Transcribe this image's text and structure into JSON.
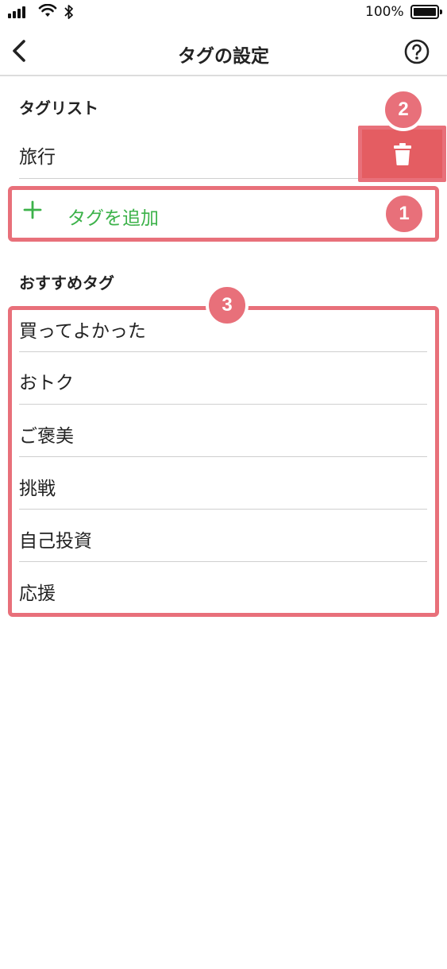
{
  "status_bar": {
    "battery_percent": "100%",
    "icons": [
      "cellular-signal-icon",
      "wifi-icon",
      "bluetooth-icon",
      "battery-icon"
    ]
  },
  "nav": {
    "title": "タグの設定",
    "back_icon": "chevron-left-icon",
    "help_icon": "help-circle-icon"
  },
  "tag_list": {
    "header": "タグリスト",
    "items": [
      {
        "label": "旅行"
      }
    ],
    "delete_icon": "trash-icon",
    "delete_color": "#e45d62",
    "add_label": "タグを追加",
    "add_icon": "plus-icon",
    "add_color": "#3cb24a"
  },
  "recommended": {
    "header": "おすすめタグ",
    "items": [
      {
        "label": "買ってよかった"
      },
      {
        "label": "おトク"
      },
      {
        "label": "ご褒美"
      },
      {
        "label": "挑戦"
      },
      {
        "label": "自己投資"
      },
      {
        "label": "応援"
      }
    ]
  },
  "annotations": {
    "color": "#e8707a",
    "callouts": [
      "1",
      "2",
      "3"
    ]
  }
}
